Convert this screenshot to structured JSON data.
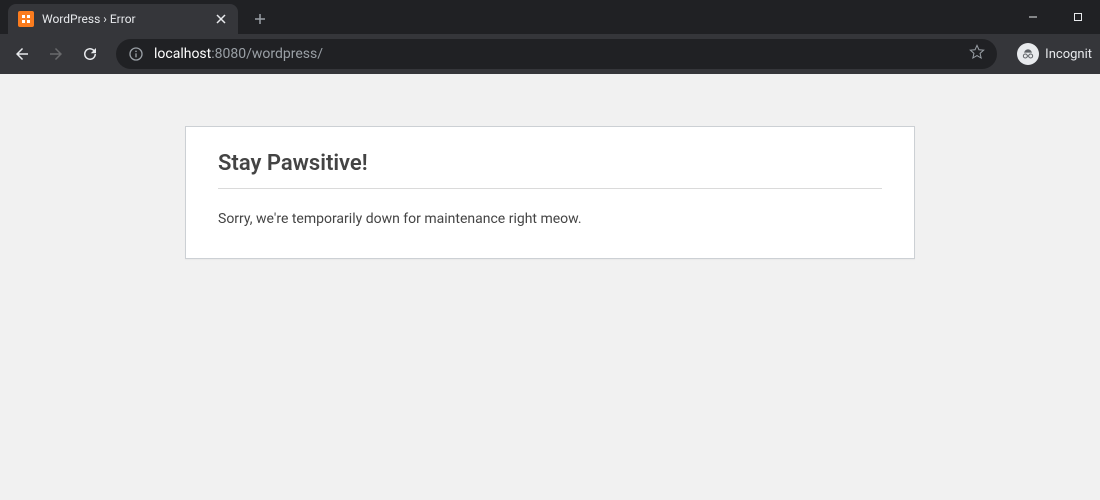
{
  "tab": {
    "title": "WordPress › Error",
    "favicon_letter": "⋈"
  },
  "omnibox": {
    "host": "localhost",
    "port_path": ":8080/wordpress/"
  },
  "incognito": {
    "label": "Incognit"
  },
  "page": {
    "heading": "Stay Pawsitive!",
    "message": "Sorry, we're temporarily down for maintenance right meow."
  }
}
